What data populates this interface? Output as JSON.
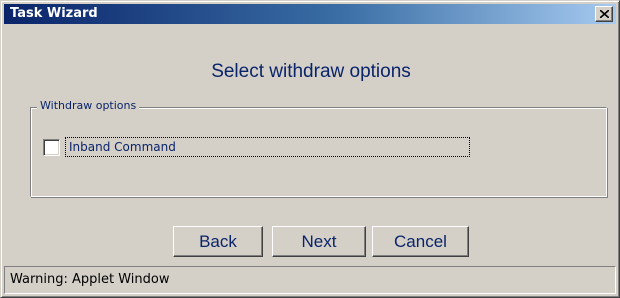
{
  "window": {
    "title": "Task Wizard"
  },
  "page": {
    "heading": "Select withdraw options"
  },
  "options_group": {
    "legend": "Withdraw options",
    "items": [
      {
        "label": "Inband Command",
        "checked": false
      }
    ]
  },
  "buttons": {
    "back": "Back",
    "next": "Next",
    "cancel": "Cancel"
  },
  "status": {
    "text": "Warning: Applet Window"
  },
  "colors": {
    "title_gradient_start": "#0a246a",
    "title_gradient_end": "#a6caf0",
    "window_bg": "#d4d0c8",
    "text_accent": "#0a246a"
  },
  "icons": {
    "close": "close-icon"
  }
}
